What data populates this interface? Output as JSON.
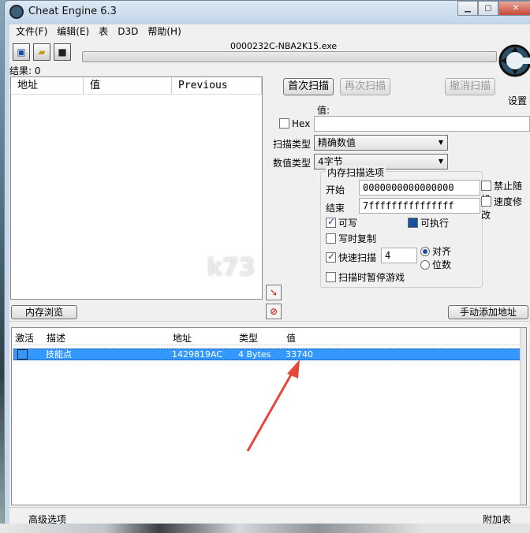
{
  "window": {
    "title": "Cheat Engine 6.3",
    "minimize": "▁",
    "restore": "▢",
    "close": "✕"
  },
  "menu": [
    "文件(F)",
    "编辑(E)",
    "表",
    "D3D",
    "帮助(H)"
  ],
  "process_title": "0000232C-NBA2K15.exe",
  "results_label": "结果: 0",
  "found_list": {
    "columns": [
      "地址",
      "值",
      "Previous"
    ]
  },
  "scan_buttons": {
    "first_scan": "首次扫描",
    "next_scan": "再次扫描",
    "undo_scan": "撤消扫描"
  },
  "settings_label": "设置",
  "value_label": "值:",
  "hex_label": "Hex",
  "scan_type": {
    "label": "扫描类型",
    "value": "精确数值"
  },
  "value_type": {
    "label": "数值类型",
    "value": "4字节"
  },
  "mem_options": {
    "title": "内存扫描选项",
    "start_label": "开始",
    "start_value": "0000000000000000",
    "end_label": "结束",
    "end_value": "7fffffffffffffff",
    "writable": "可写",
    "executable": "可执行",
    "copy_on_write": "写时复制",
    "fast_scan": "快速扫描",
    "fast_scan_value": "4",
    "align": "对齐",
    "last_digits": "位数",
    "pause_game": "扫描时暂停游戏"
  },
  "right_options": {
    "unrandomizer": "禁止随机",
    "speedhack": "速度修改"
  },
  "memory_view_button": "内存浏览",
  "add_address_button": "手动添加地址",
  "cheat_table": {
    "columns": [
      "激活",
      "描述",
      "地址",
      "类型",
      "值"
    ],
    "rows": [
      {
        "active": false,
        "description": "技能点",
        "address": "1429819AC",
        "type": "4 Bytes",
        "value": "33740"
      }
    ]
  },
  "status": {
    "advanced": "高级选项",
    "table_extras": "附加表"
  },
  "watermark": "k73",
  "colors": {
    "selection": "#3399ff",
    "arrow": "#e5483a",
    "title_bg": "#c8d8e8"
  }
}
